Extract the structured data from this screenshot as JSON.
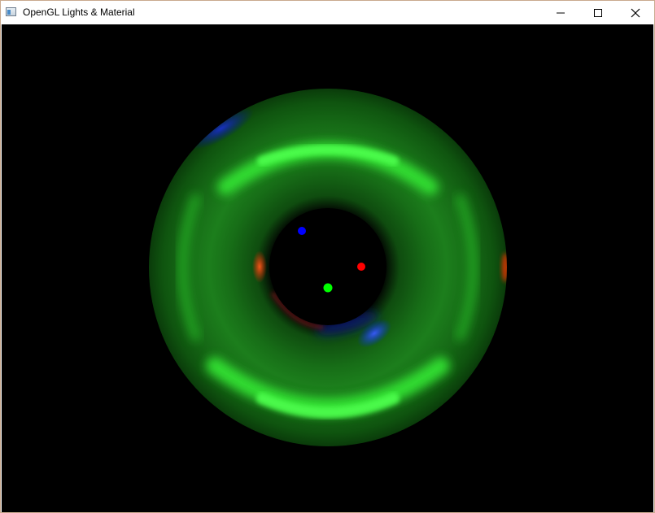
{
  "window": {
    "title": "OpenGL Lights & Material",
    "icon": "application-window-icon",
    "controls": [
      "minimize-icon",
      "maximize-icon",
      "close-icon"
    ]
  },
  "scene": {
    "background_color": "#000000",
    "object": "torus",
    "material_color": "#1a8f1a",
    "specular_highlight_color": "#3dff3d",
    "lights": [
      {
        "name": "blue-light",
        "color": "#0000ff"
      },
      {
        "name": "red-light",
        "color": "#ff0000"
      },
      {
        "name": "green-light",
        "color": "#00ff00"
      }
    ]
  }
}
